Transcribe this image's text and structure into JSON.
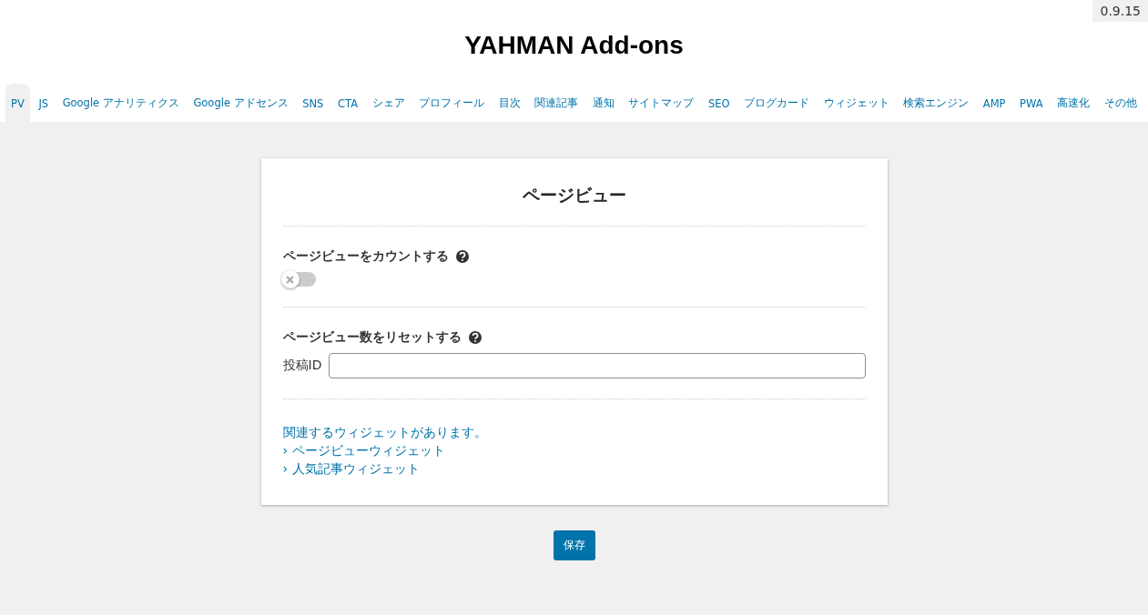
{
  "version": "0.9.15",
  "title": "YAHMAN Add-ons",
  "tabs": [
    {
      "label": "PV",
      "selected": true
    },
    {
      "label": "JS",
      "selected": false
    },
    {
      "label": "Google アナリティクス",
      "selected": false
    },
    {
      "label": "Google アドセンス",
      "selected": false
    },
    {
      "label": "SNS",
      "selected": false
    },
    {
      "label": "CTA",
      "selected": false
    },
    {
      "label": "シェア",
      "selected": false
    },
    {
      "label": "プロフィール",
      "selected": false
    },
    {
      "label": "目次",
      "selected": false
    },
    {
      "label": "関連記事",
      "selected": false
    },
    {
      "label": "通知",
      "selected": false
    },
    {
      "label": "サイトマップ",
      "selected": false
    },
    {
      "label": "SEO",
      "selected": false
    },
    {
      "label": "ブログカード",
      "selected": false
    },
    {
      "label": "ウィジェット",
      "selected": false
    },
    {
      "label": "検索エンジン",
      "selected": false
    },
    {
      "label": "AMP",
      "selected": false
    },
    {
      "label": "PWA",
      "selected": false
    },
    {
      "label": "高速化",
      "selected": false
    },
    {
      "label": "その他",
      "selected": false
    }
  ],
  "panel": {
    "heading": "ページビュー",
    "sections": [
      {
        "kind": "toggle",
        "label": "ページビューをカウントする",
        "on": false
      },
      {
        "kind": "field",
        "label": "ページビュー数をリセットする",
        "field_label": "投稿ID"
      }
    ],
    "note": "関連するウィジェットがあります。",
    "links": [
      "› ページビューウィジェット",
      "› 人気記事ウィジェット"
    ]
  },
  "save_button": "保存"
}
